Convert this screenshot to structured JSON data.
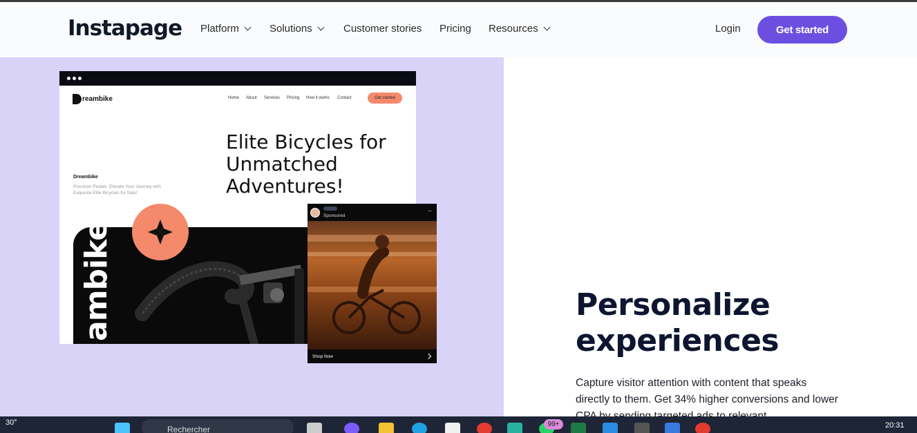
{
  "navbar": {
    "logo": "Instapage",
    "items": [
      {
        "label": "Platform",
        "dropdown": true
      },
      {
        "label": "Solutions",
        "dropdown": true
      },
      {
        "label": "Customer stories",
        "dropdown": false
      },
      {
        "label": "Pricing",
        "dropdown": false
      },
      {
        "label": "Resources",
        "dropdown": true
      }
    ],
    "login": "Login",
    "cta": "Get started"
  },
  "mockup": {
    "brand_logo": "reambike",
    "nav": [
      "Home",
      "About",
      "Services",
      "Pricing",
      "How it works",
      "Contact"
    ],
    "nav_cta": "Get started",
    "headline": "Elite Bicycles for Unmatched Adventures!",
    "brand_name": "Dreambike",
    "tagline": "Precision Pedals: Elevate Your Journey with Exquisite Elite Bicycles for Sale!",
    "vertical_text": "ambike"
  },
  "ad_card": {
    "sponsored": "Sponsored",
    "more": "···",
    "shop_now": "Shop Now"
  },
  "feature": {
    "title": "Personalize experiences",
    "description": "Capture visitor attention with content that speaks directly to them. Get 34% higher conversions and lower CPA by sending targeted ads to relevant"
  },
  "taskbar": {
    "weather": "30°",
    "search_placeholder": "Rechercher",
    "notification_badge": "99+",
    "time": "20:31"
  },
  "colors": {
    "accent": "#6c4fe0",
    "lavender": "#d9d3f7",
    "orange": "#f4896b",
    "heading": "#0d1530"
  }
}
